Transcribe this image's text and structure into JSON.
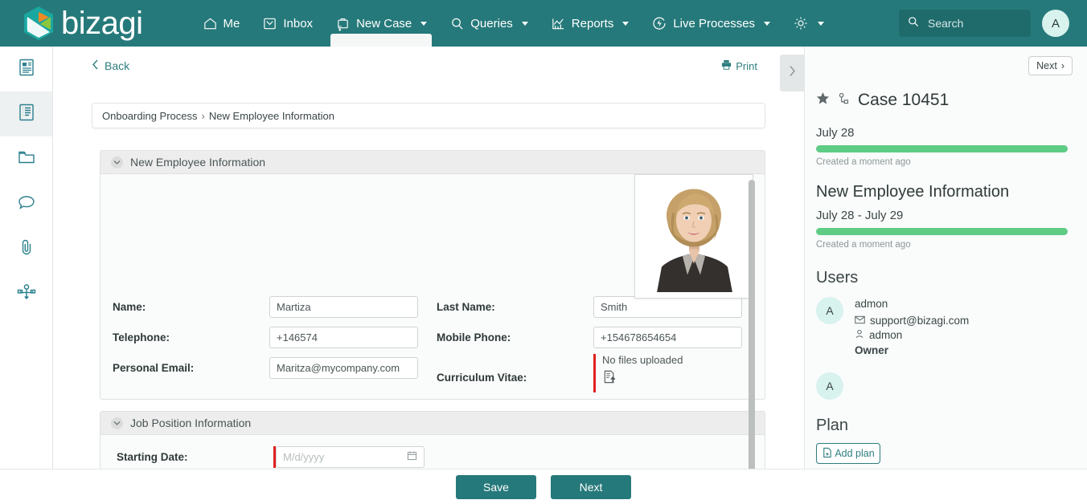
{
  "brand": {
    "name": "bizagi",
    "teal": "#26797a",
    "accent_green": "#5fcc85",
    "accent_orange": "#f08a24"
  },
  "topnav": {
    "items": [
      {
        "label": "Me",
        "icon": "home-icon",
        "has_caret": false,
        "active": false
      },
      {
        "label": "Inbox",
        "icon": "inbox-icon",
        "has_caret": false,
        "active": false
      },
      {
        "label": "New Case",
        "icon": "briefcase-plus-icon",
        "has_caret": true,
        "active": true
      },
      {
        "label": "Queries",
        "icon": "search-icon",
        "has_caret": true,
        "active": false
      },
      {
        "label": "Reports",
        "icon": "chart-icon",
        "has_caret": true,
        "active": false
      },
      {
        "label": "Live Processes",
        "icon": "lightning-circle-icon",
        "has_caret": true,
        "active": false
      },
      {
        "label": "",
        "icon": "gear-icon",
        "has_caret": true,
        "active": false
      }
    ],
    "search": {
      "placeholder": "Search",
      "value": ""
    },
    "avatar_initial": "A"
  },
  "leftrail": {
    "items": [
      {
        "icon": "summary-document-icon",
        "active": false
      },
      {
        "icon": "form-list-icon",
        "active": true
      },
      {
        "icon": "folder-icon",
        "active": false
      },
      {
        "icon": "comment-icon",
        "active": false
      },
      {
        "icon": "paperclip-icon",
        "active": false
      },
      {
        "icon": "process-flow-icon",
        "active": false
      }
    ],
    "expand_icon": "chevron-double-right-icon"
  },
  "toolbar": {
    "back_label": "Back",
    "print_label": "Print",
    "panel_toggle_icon": "chevron-right-icon"
  },
  "breadcrumb": {
    "root": "Onboarding Process",
    "separator": "›",
    "current": "New Employee Information"
  },
  "form": {
    "sections": [
      {
        "title": "New Employee Information",
        "collapsed": false,
        "photo_alt": "employee-photo",
        "fields": [
          {
            "label": "Name:",
            "value": "Martiza",
            "type": "text",
            "required": false
          },
          {
            "label": "Last Name:",
            "value": "Smith",
            "type": "text",
            "required": false
          },
          {
            "label": "Telephone:",
            "value": "+146574",
            "type": "text",
            "required": false
          },
          {
            "label": "Mobile Phone:",
            "value": "+154678654654",
            "type": "text",
            "required": false
          },
          {
            "label": "Personal Email:",
            "value": "Maritza@mycompany.com",
            "type": "text",
            "required": false
          },
          {
            "label": "Curriculum Vitae:",
            "value": "No files uploaded",
            "type": "file",
            "required": true
          }
        ]
      },
      {
        "title": "Job Position Information",
        "collapsed": false,
        "fields": [
          {
            "label": "Starting Date:",
            "value": "M/d/yyyy",
            "type": "date",
            "required": true
          }
        ]
      }
    ]
  },
  "rightpanel": {
    "next_label": "Next",
    "next_caret": "›",
    "case_title": "Case 10451",
    "star_icon": "star-filled-icon",
    "assign_icon": "assign-icon",
    "timeline": [
      {
        "date": "July 28",
        "progress_pct": 100,
        "note": "Created a moment ago"
      }
    ],
    "stage_title": "New Employee Information",
    "stage_date": "July 28 - July 29",
    "stage_progress_pct": 100,
    "stage_note": "Created a moment ago",
    "users_heading": "Users",
    "users": [
      {
        "initial": "A",
        "name": "admon",
        "email": "support@bizagi.com",
        "account": "admon",
        "role": "Owner"
      },
      {
        "initial": "A",
        "name": "",
        "email": "",
        "account": "",
        "role": ""
      }
    ],
    "plan_heading": "Plan",
    "add_plan_label": "Add plan"
  },
  "bottombar": {
    "save_label": "Save",
    "next_label": "Next"
  }
}
